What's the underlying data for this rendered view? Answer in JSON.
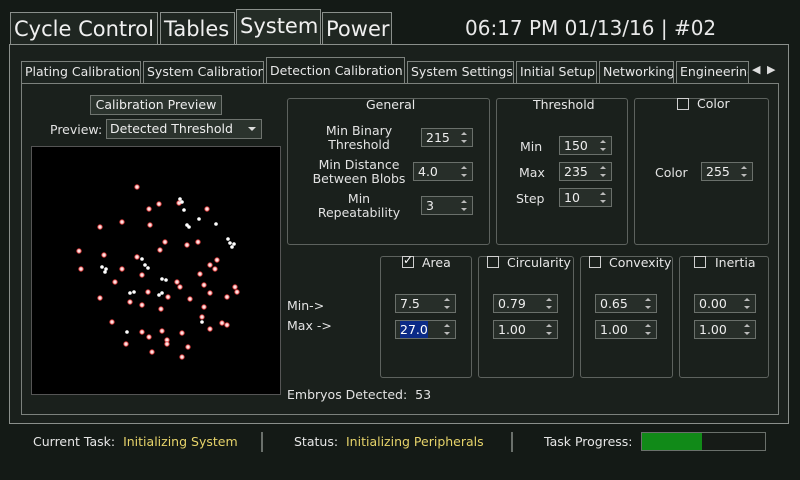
{
  "top_tabs": [
    "Cycle Control",
    "Tables",
    "System",
    "Power"
  ],
  "active_top_tab": "System",
  "header": {
    "clock": "06:17 PM 01/13/16 | #02"
  },
  "sub_tabs": [
    "Plating Calibration",
    "System Calibration",
    "Detection Calibration",
    "System Settings",
    "Initial Setup",
    "Networking",
    "Engineering"
  ],
  "active_sub_tab": "Detection Calibration",
  "preview_panel": {
    "button_label": "Calibration Preview",
    "preview_label": "Preview:",
    "preview_selected": "Detected Threshold"
  },
  "general": {
    "title": "General",
    "min_binary_threshold": {
      "label": "Min Binary\nThreshold",
      "value": "215"
    },
    "min_distance": {
      "label": "Min Distance\nBetween Blobs",
      "value": "4.0"
    },
    "min_repeatability": {
      "label": "Min\nRepeatability",
      "value": "3"
    }
  },
  "threshold": {
    "title": "Threshold",
    "min": {
      "label": "Min",
      "value": "150"
    },
    "max": {
      "label": "Max",
      "value": "235"
    },
    "step": {
      "label": "Step",
      "value": "10"
    }
  },
  "color": {
    "title": "Color",
    "checked": false,
    "label": "Color",
    "value": "255"
  },
  "filters": {
    "min_label": "Min->",
    "max_label": "Max ->",
    "area": {
      "title": "Area",
      "checked": true,
      "min": "7.5",
      "max": "27.0"
    },
    "circularity": {
      "title": "Circularity",
      "checked": false,
      "min": "0.79",
      "max": "1.00"
    },
    "convexity": {
      "title": "Convexity",
      "checked": false,
      "min": "0.65",
      "max": "1.00"
    },
    "inertia": {
      "title": "Inertia",
      "checked": false,
      "min": "0.00",
      "max": "1.00"
    }
  },
  "embryos": {
    "label": "Embryos Detected:",
    "value": "53"
  },
  "status_bar": {
    "current_task_label": "Current Task:",
    "current_task_value": "Initializing System",
    "status_label": "Status:",
    "status_value": "Initializing Peripherals",
    "progress_label": "Task Progress:",
    "progress_fraction": 0.49
  },
  "colors": {
    "accent_text": "#e6d36a",
    "progress": "#118a18",
    "selection": "#0b2a86"
  }
}
